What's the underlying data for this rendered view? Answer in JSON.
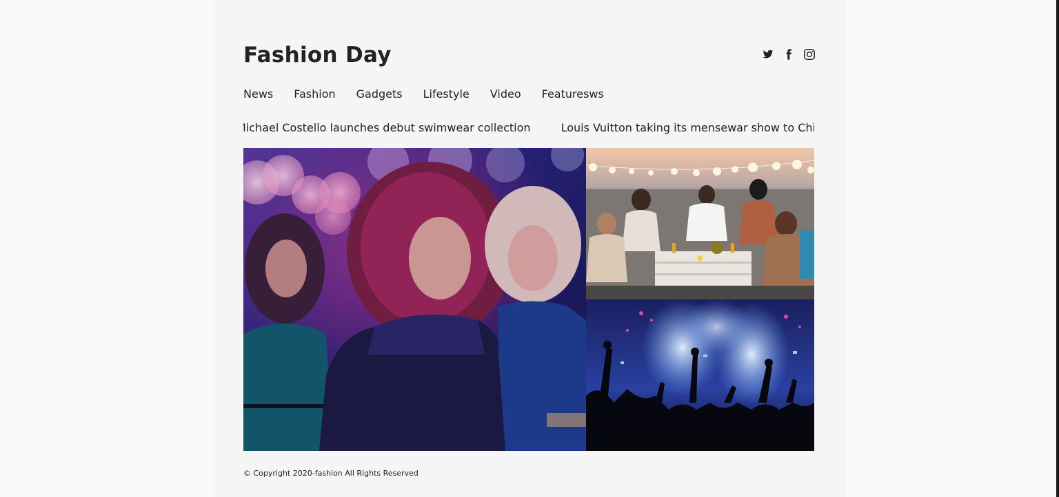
{
  "site": {
    "title": "Fashion Day"
  },
  "social": [
    {
      "icon": "twitter-icon"
    },
    {
      "icon": "facebook-icon"
    },
    {
      "icon": "instagram-icon"
    }
  ],
  "nav": {
    "items": [
      {
        "label": "News"
      },
      {
        "label": "Fashion"
      },
      {
        "label": "Gadgets"
      },
      {
        "label": "Lifestyle"
      },
      {
        "label": "Video"
      },
      {
        "label": "Featuresws"
      }
    ]
  },
  "ticker": {
    "items": [
      {
        "text": "Michael Costello launches debut swimwear collection"
      },
      {
        "text": "Louis Vuitton taking its mensewar show to China"
      }
    ]
  },
  "gallery": {
    "main": {
      "subject": "women-dancing-at-party"
    },
    "top_right": {
      "subject": "friends-at-beach-party"
    },
    "bottom_right": {
      "subject": "concert-crowd"
    }
  },
  "footer": {
    "copyright": "© Copyright 2020-fashion All Rights Reserved"
  },
  "colors": {
    "page_bg": "#f5f5f5",
    "outer_bg": "#fafafa",
    "text": "#222222"
  }
}
